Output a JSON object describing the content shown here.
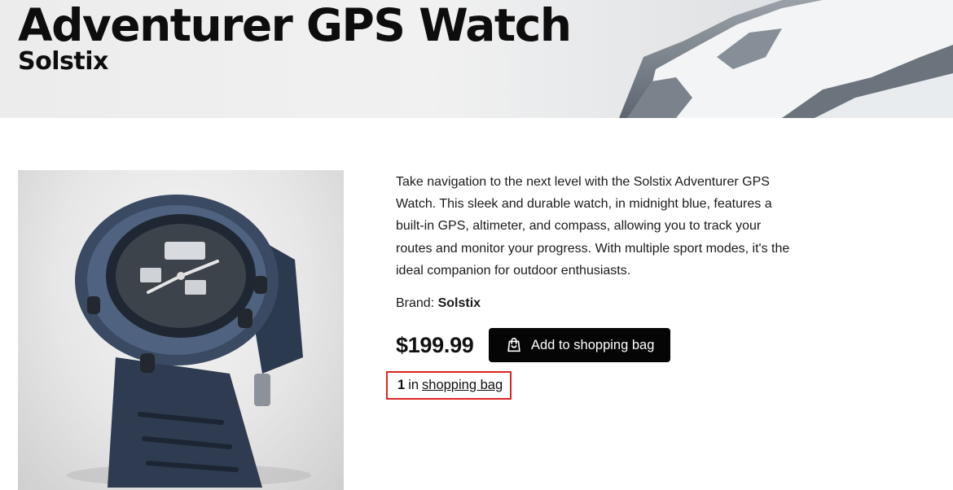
{
  "hero": {
    "title": "Adventurer GPS Watch",
    "subtitle": "Solstix"
  },
  "product": {
    "image_alt": "Midnight blue Adventurer GPS watch",
    "description": "Take navigation to the next level with the Solstix Adventurer GPS Watch. This sleek and durable watch, in midnight blue, features a built-in GPS, altimeter, and compass, allowing you to track your routes and monitor your progress. With multiple sport modes, it's the ideal companion for outdoor enthusiasts.",
    "brand_label": "Brand:",
    "brand_value": "Solstix",
    "price": "$199.99",
    "add_button_label": "Add to shopping bag",
    "bag_count": "1",
    "bag_in_text": "in",
    "bag_link_text": "shopping bag"
  },
  "colors": {
    "button_bg": "#050505",
    "highlight_border": "#e02424",
    "watch_body": "#34435c"
  }
}
